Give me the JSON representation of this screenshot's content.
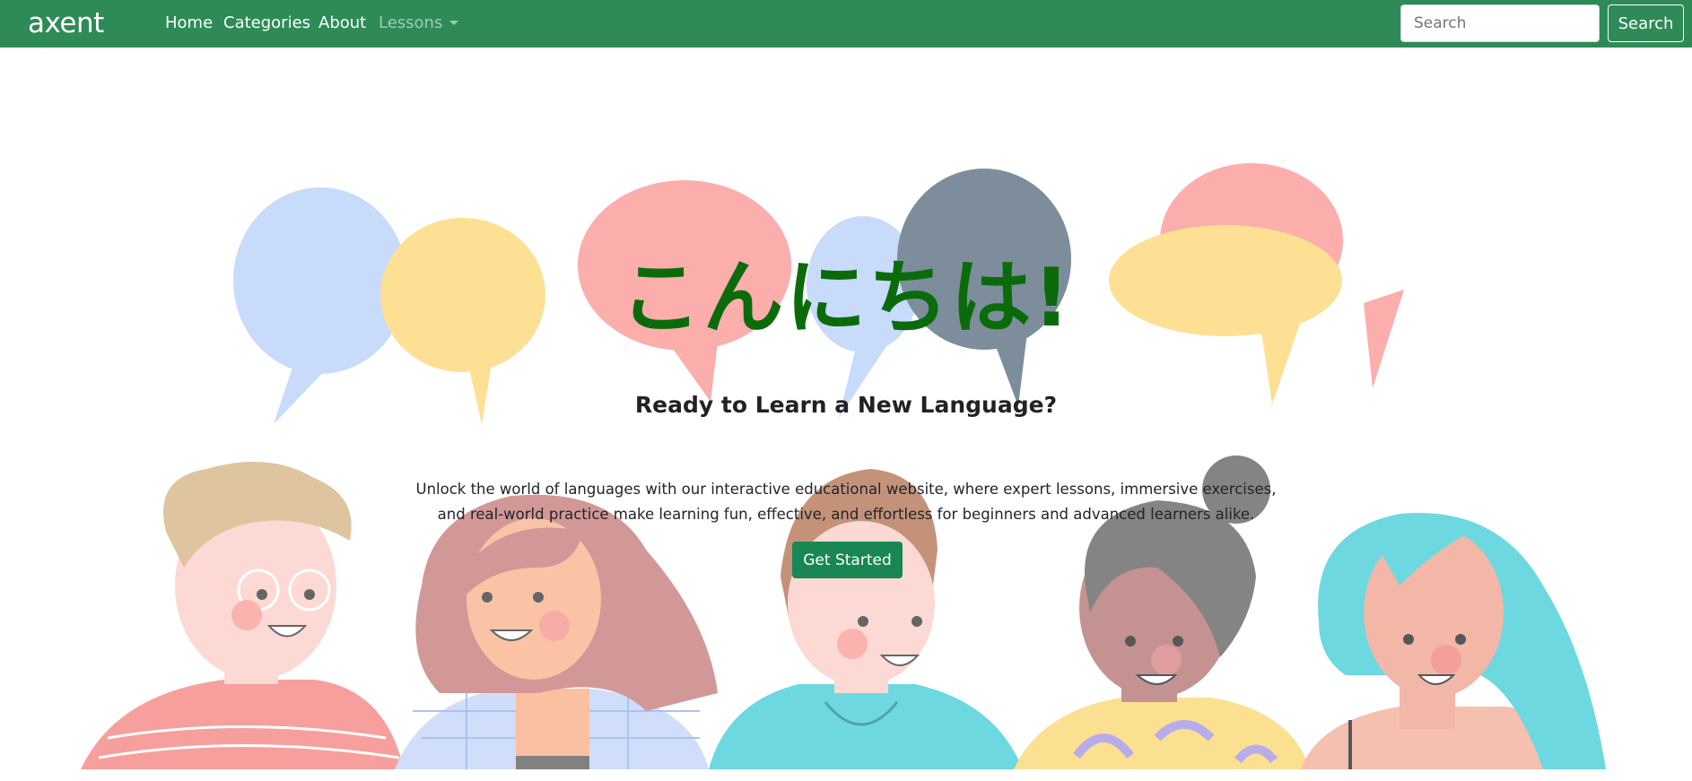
{
  "navbar": {
    "brand": "axent",
    "links": [
      "Home",
      "Categories",
      "About"
    ],
    "dropdown_label": "Lessons",
    "search": {
      "placeholder": "Search",
      "button_label": "Search"
    }
  },
  "hero": {
    "greeting": "こんにちは!",
    "headline": "Ready to Learn a New Language?",
    "blurb_line1": "Unlock the world of languages with our interactive educational website, where expert lessons, immersive exercises,",
    "blurb_line2": "and real-world practice make learning fun, effective, and effortless for beginners and advanced learners alike.",
    "cta_label": "Get Started"
  },
  "colors": {
    "nav_bg": "#2e8b57",
    "greeting": "#0b6b0b",
    "cta_bg": "#198754"
  },
  "icons": [
    "chevron-down-icon"
  ]
}
